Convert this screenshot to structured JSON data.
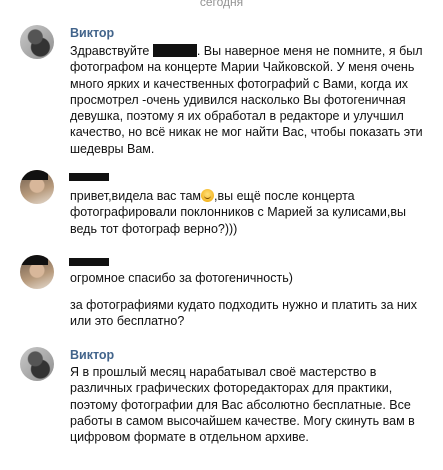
{
  "date_separator": "сегодня",
  "messages": [
    {
      "author": "Виктор",
      "before_redact": "Здравствуйте ",
      "after_redact": ". Вы наверное меня не помните, я был\nфотографом на концерте Марии Чайковской. У меня очень\nмного ярких и качественных фотографий с Вами, когда их\nпросмотрел -очень удивился насколько Вы фотогеничная\nдевушка, поэтому я их обработал в редакторе и улучшил\nкачество, но всё никак не мог найти Вас, чтобы показать эти\nшедевры Вам."
    },
    {
      "before_emoji": "привет,видела вас там",
      "after_emoji": ",вы ещё после концерта\nфотографировали поклонников с Марией за кулисами,вы\nведь тот фотограф верно?)))"
    },
    {
      "line1": "огромное спасибо за фотогеничность)",
      "line2": "за фотографиями кудато подходить нужно и платить за них\nили это бесплатно?"
    },
    {
      "author": "Виктор",
      "text": "Я в прошлый месяц нарабатывал своё мастерство в\nразличных графических фоторедакторах для практики,\nпоэтому фотографии для Вас абсолютно бесплатные. Все\nработы в самом высочайшем качестве. Могу скинуть вам в\nцифровом формате в отдельном архиве."
    }
  ]
}
